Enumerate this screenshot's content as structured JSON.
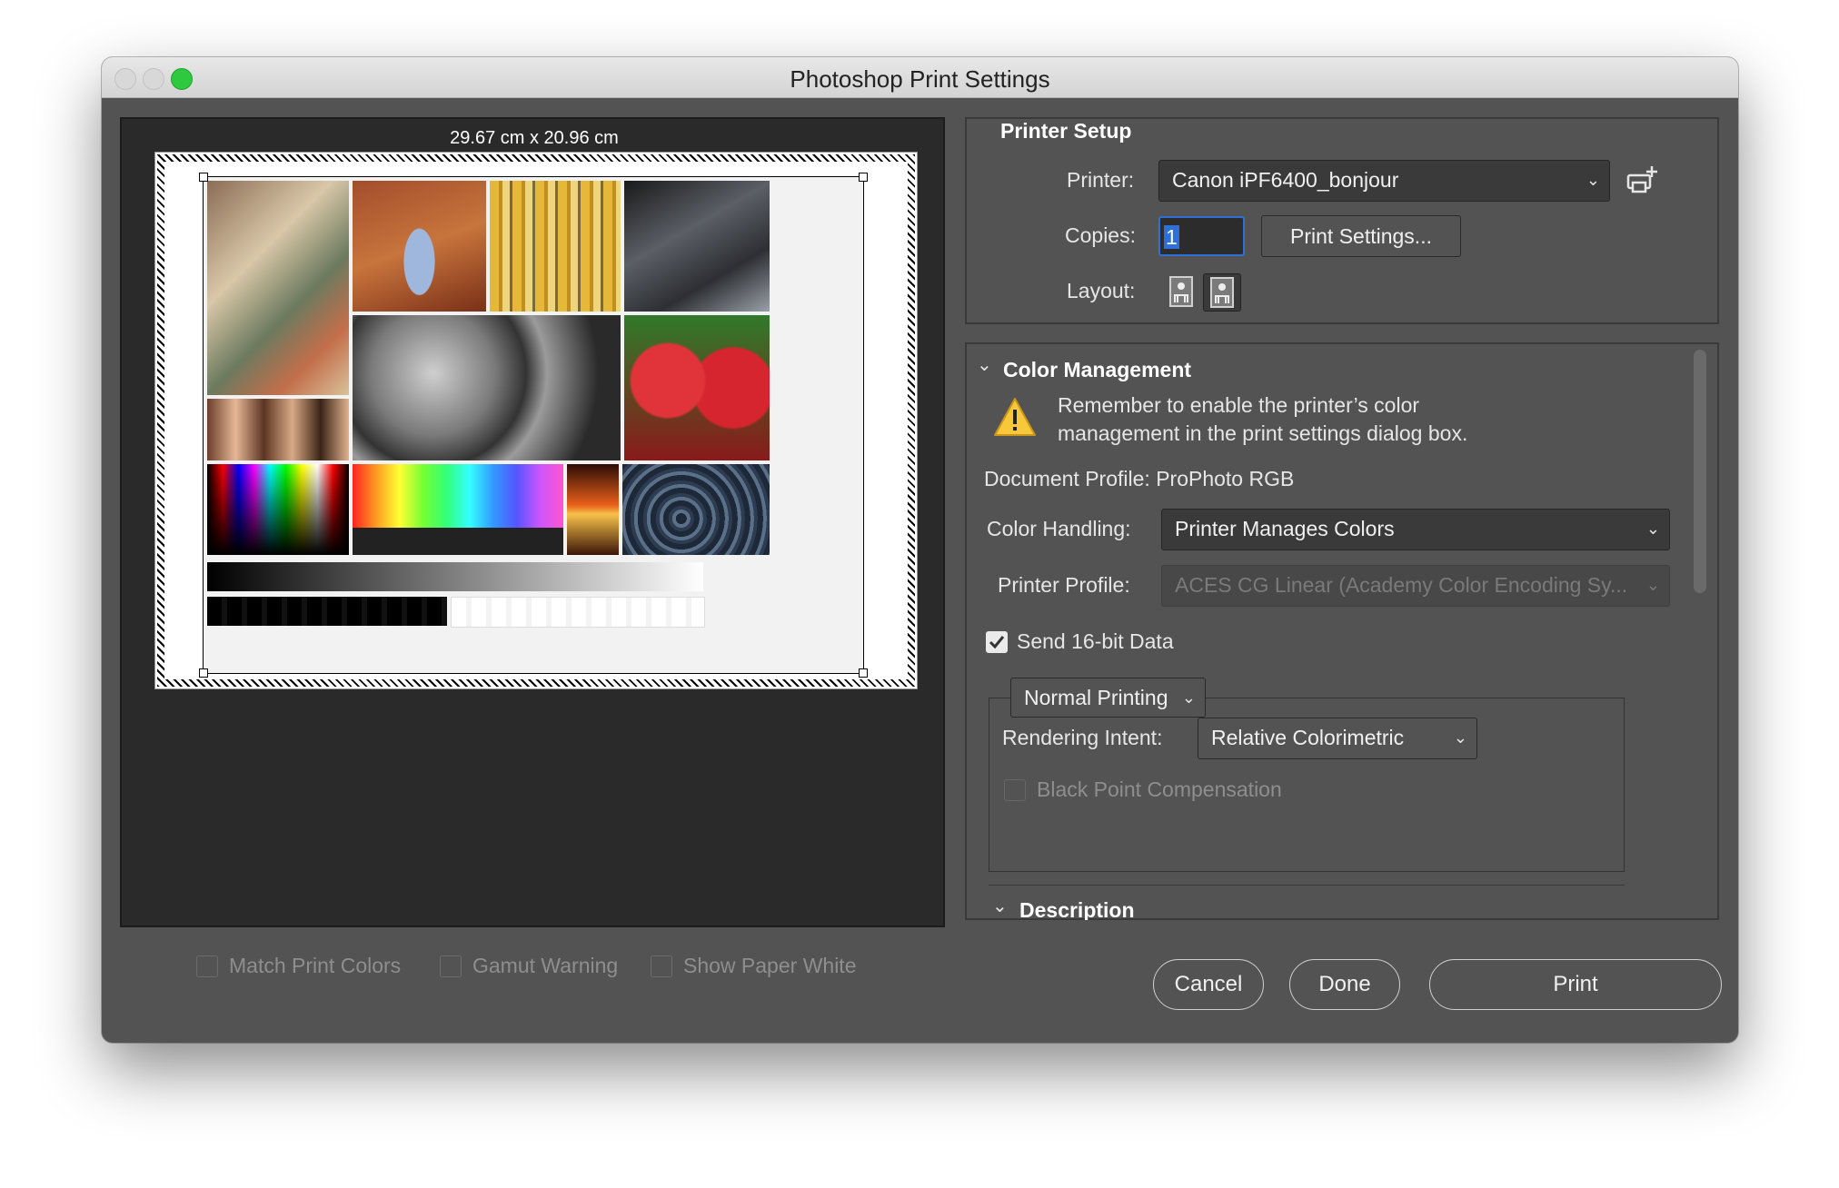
{
  "window": {
    "title": "Photoshop Print Settings"
  },
  "preview": {
    "dimensions": "29.67 cm x 20.96 cm"
  },
  "preview_options": {
    "match_print_colors": {
      "label": "Match Print Colors",
      "checked": false
    },
    "gamut_warning": {
      "label": "Gamut Warning",
      "checked": false
    },
    "show_paper_white": {
      "label": "Show Paper White",
      "checked": false
    }
  },
  "printer_setup": {
    "heading": "Printer Setup",
    "printer_label": "Printer:",
    "printer_value": "Canon iPF6400_bonjour",
    "copies_label": "Copies:",
    "copies_value": "1",
    "print_settings_button": "Print Settings...",
    "layout_label": "Layout:"
  },
  "color_management": {
    "heading": "Color Management",
    "warning_line1": "Remember to enable the printer’s color",
    "warning_line2": "management in the print settings dialog box.",
    "document_profile": "Document Profile: ProPhoto RGB",
    "color_handling_label": "Color Handling:",
    "color_handling_value": "Printer Manages Colors",
    "printer_profile_label": "Printer Profile:",
    "printer_profile_value": "ACES CG Linear (Academy Color Encoding Sy...",
    "send_16bit": {
      "label": "Send 16-bit Data",
      "checked": true
    },
    "printing_mode": "Normal Printing",
    "rendering_intent_label": "Rendering Intent:",
    "rendering_intent_value": "Relative Colorimetric",
    "black_point": {
      "label": "Black Point Compensation",
      "checked": false
    }
  },
  "description": {
    "heading": "Description"
  },
  "buttons": {
    "cancel": "Cancel",
    "done": "Done",
    "print": "Print"
  },
  "colors": {
    "accent_blue": "#2f6fd8",
    "window_bg": "#535353",
    "green_light": "#2fc940"
  },
  "icons": [
    "warning-icon",
    "add-printer-icon",
    "portrait-layout-icon",
    "landscape-layout-icon",
    "chevron-down-icon",
    "checkmark-icon"
  ]
}
